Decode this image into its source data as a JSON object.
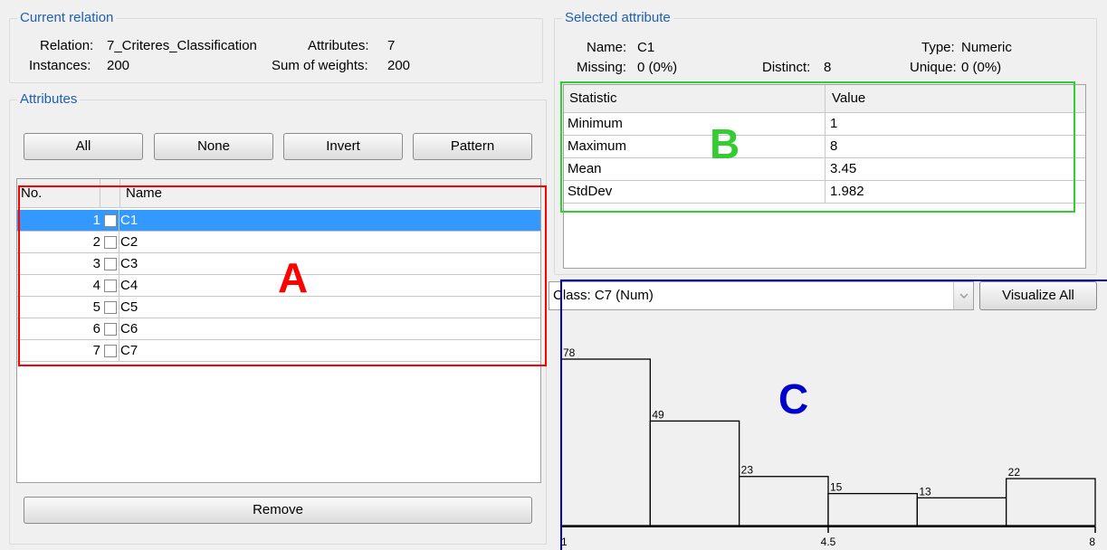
{
  "current_relation": {
    "legend": "Current relation",
    "relation_label": "Relation:",
    "relation_value": "7_Criteres_Classification",
    "attributes_label": "Attributes:",
    "attributes_value": "7",
    "instances_label": "Instances:",
    "instances_value": "200",
    "weights_label": "Sum of weights:",
    "weights_value": "200"
  },
  "attributes": {
    "legend": "Attributes",
    "buttons": {
      "all": "All",
      "none": "None",
      "invert": "Invert",
      "pattern": "Pattern"
    },
    "columns": {
      "no": "No.",
      "name": "Name"
    },
    "rows": [
      {
        "no": "1",
        "name": "C1",
        "selected": true
      },
      {
        "no": "2",
        "name": "C2",
        "selected": false
      },
      {
        "no": "3",
        "name": "C3",
        "selected": false
      },
      {
        "no": "4",
        "name": "C4",
        "selected": false
      },
      {
        "no": "5",
        "name": "C5",
        "selected": false
      },
      {
        "no": "6",
        "name": "C6",
        "selected": false
      },
      {
        "no": "7",
        "name": "C7",
        "selected": false
      }
    ],
    "remove_button": "Remove"
  },
  "selected_attribute": {
    "legend": "Selected attribute",
    "name_label": "Name:",
    "name_value": "C1",
    "type_label": "Type:",
    "type_value": "Numeric",
    "missing_label": "Missing:",
    "missing_value": "0 (0%)",
    "distinct_label": "Distinct:",
    "distinct_value": "8",
    "unique_label": "Unique:",
    "unique_value": "0 (0%)",
    "columns": {
      "statistic": "Statistic",
      "value": "Value"
    },
    "stats": [
      {
        "statistic": "Minimum",
        "value": "1"
      },
      {
        "statistic": "Maximum",
        "value": "8"
      },
      {
        "statistic": "Mean",
        "value": "3.45"
      },
      {
        "statistic": "StdDev",
        "value": "1.982"
      }
    ]
  },
  "class_selector": {
    "value": "Class: C7 (Num)",
    "visualize_all": "Visualize All"
  },
  "annotations": {
    "a": "A",
    "b": "B",
    "c": "C"
  },
  "colors": {
    "legend": "#1f5fb0",
    "selection": "#3399ff",
    "box_a": "#ff0000",
    "box_b": "#33cc33",
    "box_c": "#0000cc"
  },
  "chart_data": {
    "type": "bar",
    "title": "",
    "xlabel": "",
    "ylabel": "",
    "bin_counts": [
      78,
      49,
      23,
      15,
      13,
      22
    ],
    "x_range": [
      1,
      8
    ],
    "x_tick_labels": [
      "1",
      "4.5",
      "8"
    ],
    "value_labels": [
      "78",
      "49",
      "23",
      "15",
      "13",
      "22"
    ],
    "grid": false
  }
}
